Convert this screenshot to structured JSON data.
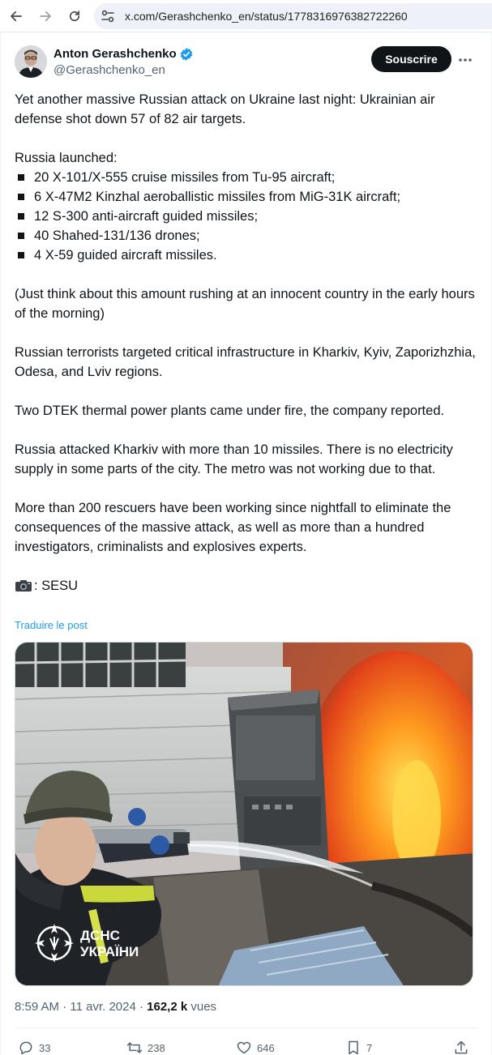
{
  "browser": {
    "url": "x.com/Gerashchenko_en/status/1778316976382722260"
  },
  "author": {
    "name": "Anton Gerashchenko",
    "handle": "@Gerashchenko_en",
    "subscribe_label": "Souscrire"
  },
  "tweet": {
    "intro": "Yet another massive Russian attack on Ukraine last night: Ukrainian air defense shot down 57 of 82 air targets.",
    "launched_heading": "Russia launched:",
    "launched_items": [
      "20 X-101/X-555 cruise missiles from Tu-95 aircraft;",
      "6 X-47M2 Kinzhal aeroballistic missiles from MiG-31K aircraft;",
      "12 S-300 anti-aircraft guided missiles;",
      "40 Shahed-131/136 drones;",
      "4 X-59 guided aircraft missiles."
    ],
    "para_think": "(Just think about this amount rushing at an innocent country in the early hours of the morning)",
    "para_targets": "Russian terrorists targeted critical infrastructure in Kharkiv, Kyiv, Zaporizhzhia, Odesa, and Lviv regions.",
    "para_dtek": "Two DTEK thermal power plants came under fire, the company reported.",
    "para_kharkiv": "Russia attacked Kharkiv with more than 10 missiles. There is no electricity supply in some parts of the city. The metro was not working due to that.",
    "para_rescuers": "More than 200 rescuers have been working since nightfall to eliminate the consequences of the massive attack, as well as more than a hundred investigators, criminalists and explosives experts.",
    "credit": ": SESU",
    "translate_label": "Traduire le post"
  },
  "media": {
    "watermark_line1": "ДСНС",
    "watermark_line2": "УКРАЇНИ"
  },
  "meta": {
    "time_date": "8:59 AM · 11 avr. 2024 · ",
    "views_count": "162,2 k",
    "views_label": " vues"
  },
  "actions": {
    "replies": "33",
    "reposts": "238",
    "likes": "646",
    "bookmarks": "7"
  },
  "colors": {
    "accent": "#1d9bf0",
    "text_primary": "#0f1419",
    "text_secondary": "#536471",
    "button_dark": "#0f1419"
  },
  "icons": [
    "back-icon",
    "forward-icon",
    "reload-icon",
    "site-info-icon",
    "verified-icon",
    "more-icon",
    "camera-icon",
    "reply-icon",
    "repost-icon",
    "like-icon",
    "bookmark-icon",
    "share-icon"
  ]
}
